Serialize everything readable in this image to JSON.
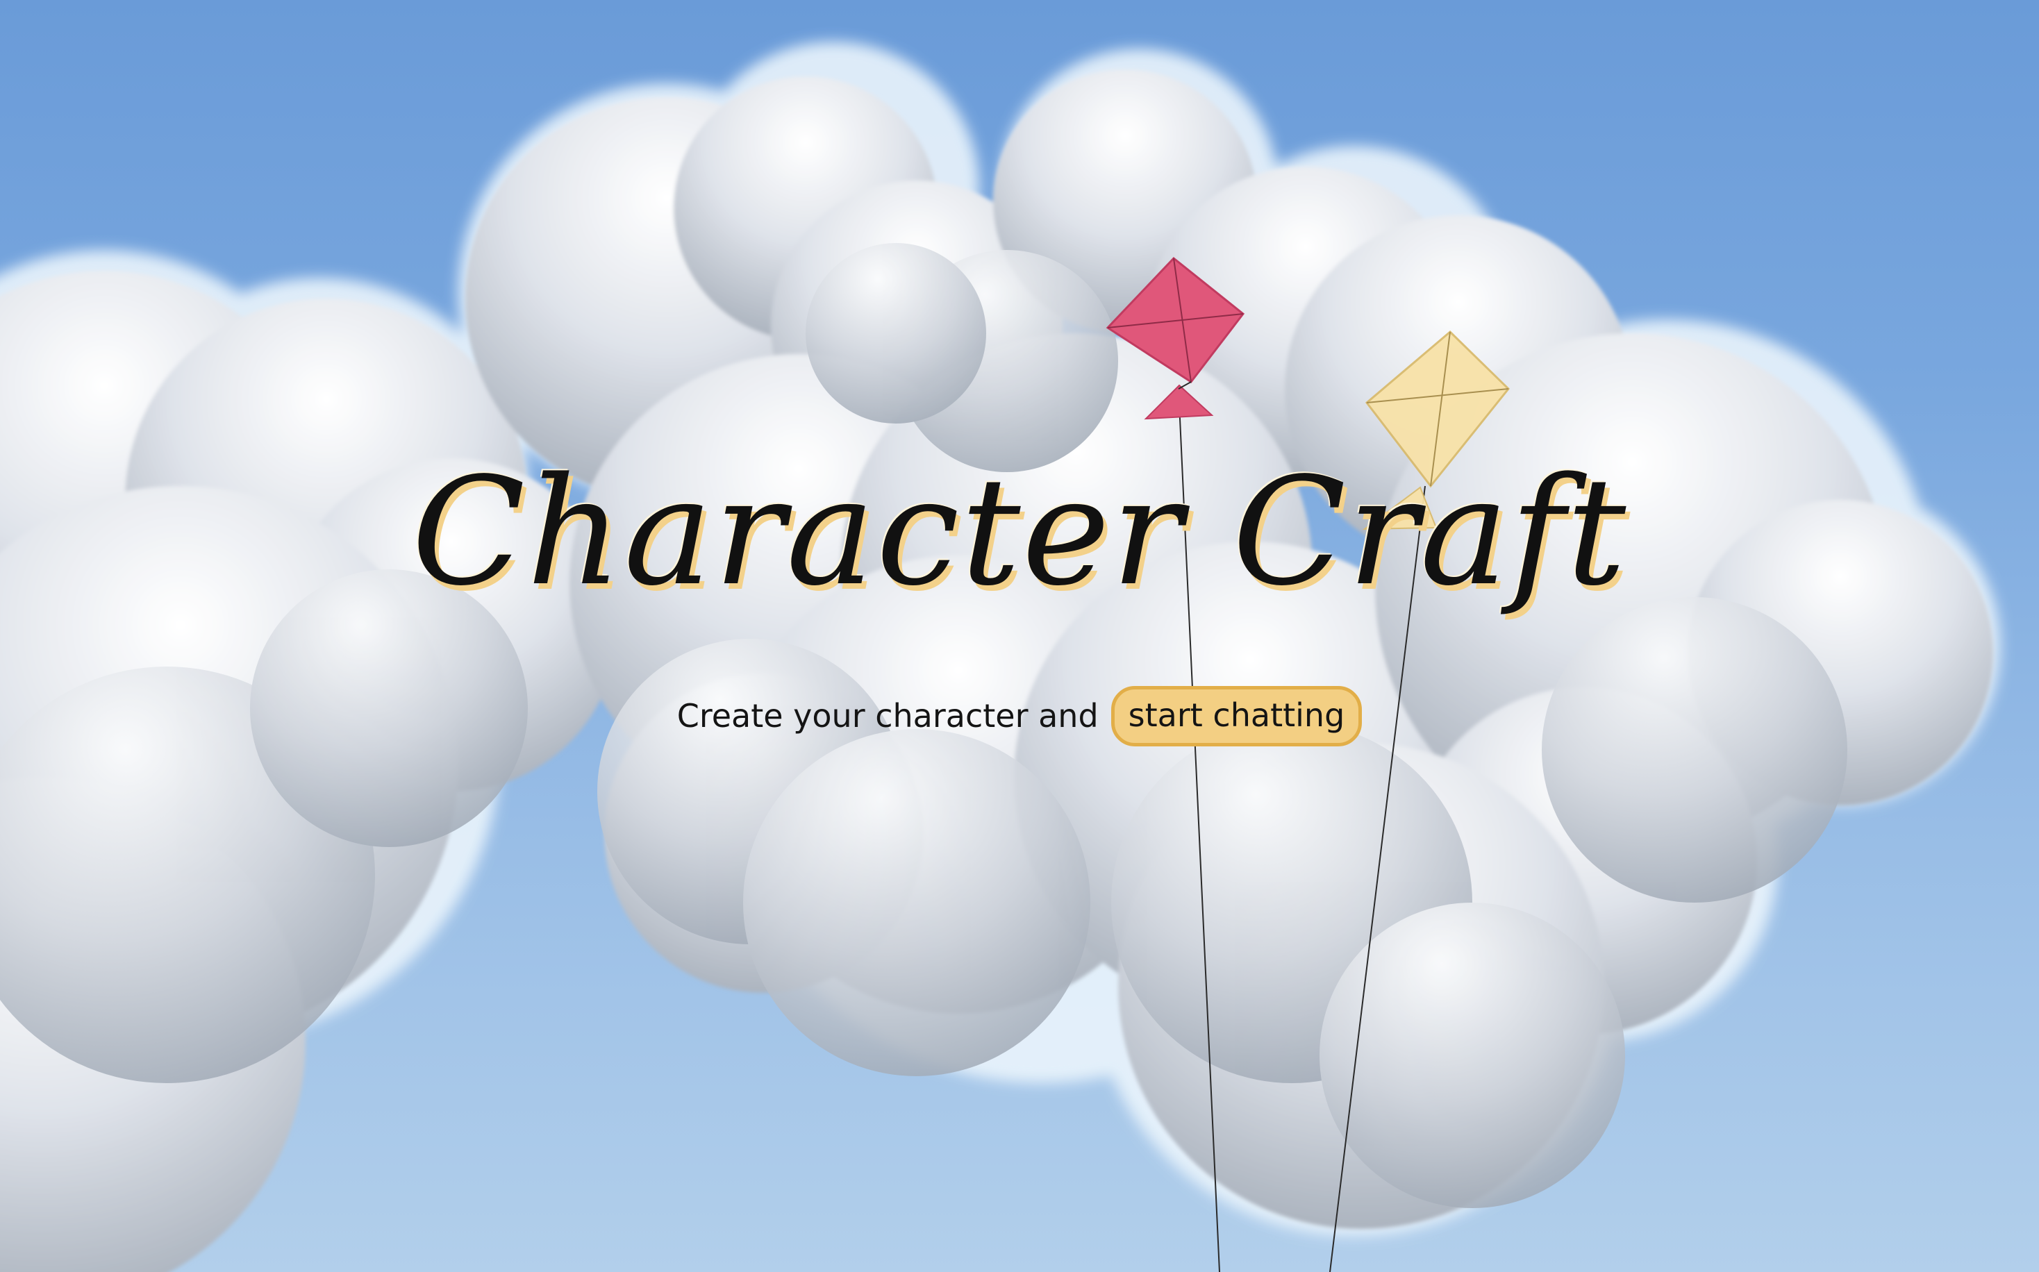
{
  "hero": {
    "title": "Character Craft",
    "tagline": "Create your character and",
    "cta_label": "start chatting"
  },
  "colors": {
    "sky_top": "#6a9bd8",
    "sky_bottom": "#b2cfeb",
    "kite_pink": "#e0577a",
    "kite_yellow": "#f8e2a8",
    "cta_fill": "#f3cf83",
    "cta_border": "#e2ae48",
    "title_shadow": "#f3d18a"
  },
  "icons": [
    "pink-kite-icon",
    "yellow-kite-icon"
  ]
}
